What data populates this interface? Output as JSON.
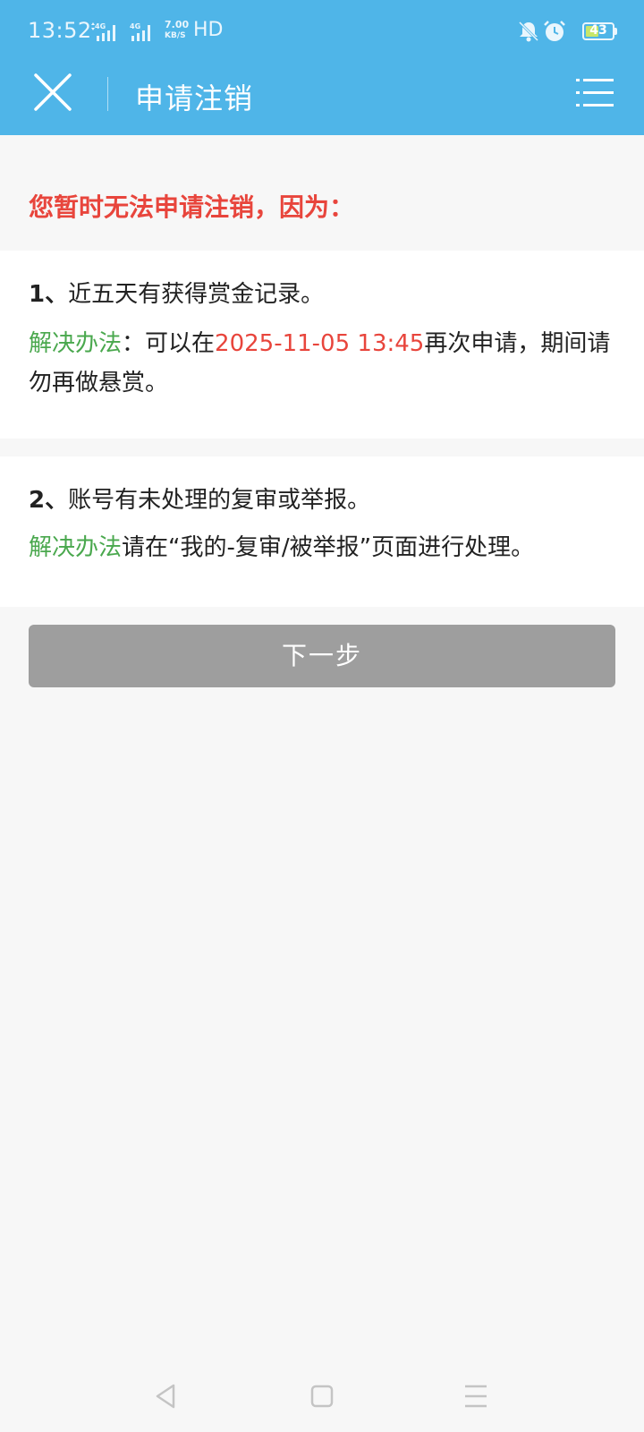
{
  "status_bar": {
    "time": "13:52",
    "signal_1_label": "4G",
    "signal_2_label": "4G",
    "net_speed_value": "7.00",
    "net_speed_unit": "KB/S",
    "hd_label": "HD",
    "battery_level": "43",
    "icons": [
      "mute-bell-icon",
      "alarm-clock-icon",
      "battery-icon"
    ]
  },
  "header": {
    "title": "申请注销",
    "left_icon": "close-icon",
    "right_icon": "menu-list-icon"
  },
  "notice": "您暂时无法申请注销，因为：",
  "reasons": [
    {
      "index": "1、",
      "text": "近五天有获得赏金记录。",
      "solution_label": "解决办法",
      "solution_sep": "：可以在",
      "solution_date": "2025-11-05 13:45",
      "solution_rest": "再次申请，期间请勿再做悬赏。"
    },
    {
      "index": "2、",
      "text": "账号有未处理的复审或举报。",
      "solution_label": "解决办法",
      "solution_rest": "请在“我的-复审/被举报”页面进行处理。"
    }
  ],
  "next_button": "下一步",
  "nav_bar": {
    "icons": [
      "back-triangle-icon",
      "home-square-icon",
      "recents-menu-icon"
    ]
  },
  "colors": {
    "header_blue": "#4fb5e8",
    "notice_red": "#e8453c",
    "solution_green": "#4aa84e",
    "button_gray": "#9e9e9e"
  }
}
